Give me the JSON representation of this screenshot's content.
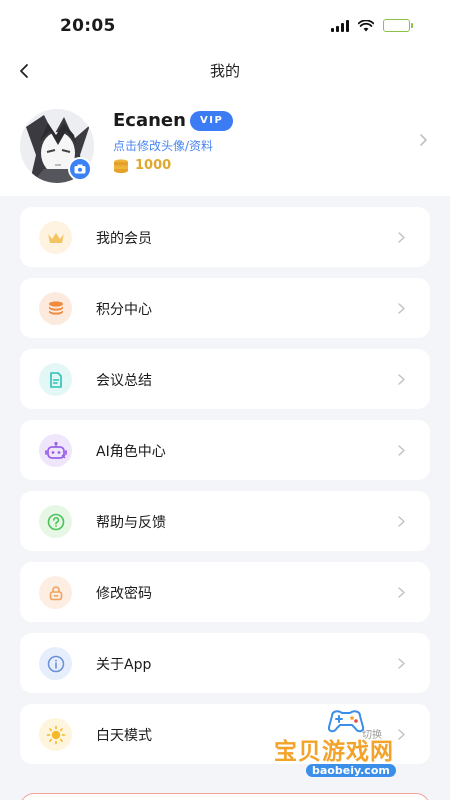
{
  "status_bar": {
    "time": "20:05"
  },
  "nav": {
    "title": "我的"
  },
  "profile": {
    "username": "Ecanen",
    "badge": "VIP",
    "edit_link": "点击修改头像/资料",
    "coins": "1000"
  },
  "menu": {
    "items": [
      {
        "label": "我的会员",
        "icon": "crown-icon",
        "bg": "#fdf3e0",
        "color": "#f3b94b"
      },
      {
        "label": "积分中心",
        "icon": "coins-icon",
        "bg": "#fdeadf",
        "color": "#f08a3e"
      },
      {
        "label": "会议总结",
        "icon": "document-icon",
        "bg": "#e3f7f6",
        "color": "#2cc2b6"
      },
      {
        "label": "AI角色中心",
        "icon": "robot-icon",
        "bg": "#efe6fb",
        "color": "#9a61e8"
      },
      {
        "label": "帮助与反馈",
        "icon": "help-icon",
        "bg": "#e6f7e6",
        "color": "#4cc25a"
      },
      {
        "label": "修改密码",
        "icon": "lock-icon",
        "bg": "#fdeee3",
        "color": "#f0a15f"
      },
      {
        "label": "关于App",
        "icon": "info-icon",
        "bg": "#e7eefb",
        "color": "#6a8fd8"
      },
      {
        "label": "白天模式",
        "icon": "sun-icon",
        "bg": "#fdf5dd",
        "color": "#f5b829"
      }
    ]
  },
  "watermark": {
    "name": "宝贝游戏网",
    "url": "baobeiy.com",
    "ghost_text": "切换"
  },
  "colors": {
    "accent": "#3b7cf5",
    "coin": "#e0a830",
    "card": "#ffffff",
    "background": "#f4f5f8"
  }
}
